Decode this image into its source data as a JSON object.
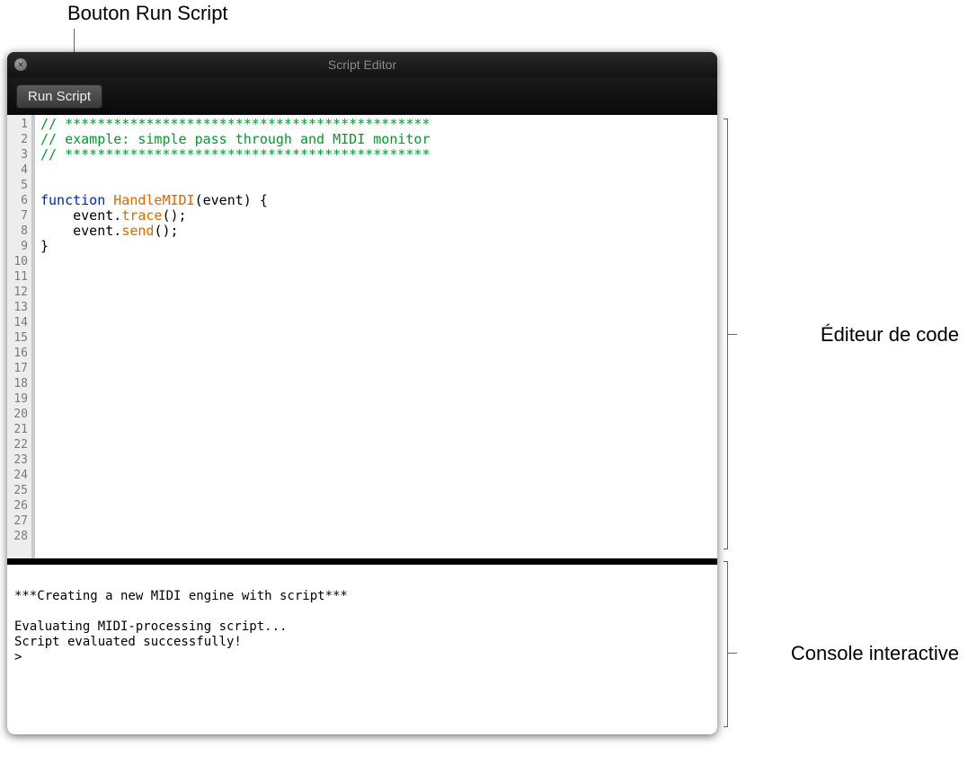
{
  "callouts": {
    "top": "Bouton Run Script",
    "editor": "Éditeur de code",
    "console": "Console interactive"
  },
  "window": {
    "title": "Script Editor",
    "close_glyph": "✕"
  },
  "toolbar": {
    "run_label": "Run Script"
  },
  "editor": {
    "line_count": 28,
    "lines": [
      {
        "n": 1,
        "t": "comment",
        "text": "// *********************************************"
      },
      {
        "n": 2,
        "t": "comment",
        "text": "// example: simple pass through and MIDI monitor"
      },
      {
        "n": 3,
        "t": "comment",
        "text": "// *********************************************"
      },
      {
        "n": 4,
        "t": "blank",
        "text": ""
      },
      {
        "n": 5,
        "t": "blank",
        "text": ""
      },
      {
        "n": 6,
        "t": "funcdecl",
        "kw": "function",
        "fn": "HandleMIDI",
        "rest": "(event) {"
      },
      {
        "n": 7,
        "t": "call",
        "indent": "    ",
        "obj": "event.",
        "m": "trace",
        "rest": "();"
      },
      {
        "n": 8,
        "t": "call",
        "indent": "    ",
        "obj": "event.",
        "m": "send",
        "rest": "();"
      },
      {
        "n": 9,
        "t": "plain",
        "text": "}"
      }
    ]
  },
  "console": {
    "lines": [
      "",
      "***Creating a new MIDI engine with script***",
      "",
      "Evaluating MIDI-processing script...",
      "Script evaluated successfully!",
      ">"
    ]
  }
}
